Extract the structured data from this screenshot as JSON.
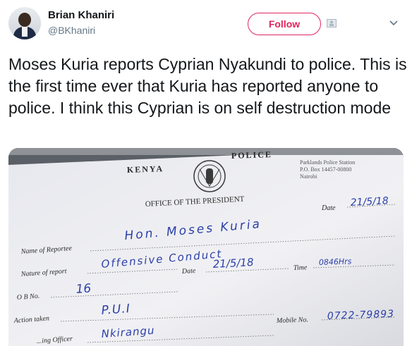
{
  "author": {
    "name": "Brian Khaniri",
    "handle": "@BKhaniri"
  },
  "actions": {
    "follow_label": "Follow",
    "follow_icon": "add-person-icon",
    "menu_icon": "chevron-down-icon"
  },
  "tweet": {
    "text": "Moses Kuria reports Cyprian Nyakundi to police. This is the first time ever that Kuria has reported anyone to police. I think this Cyprian is on self destruction mode"
  },
  "photo": {
    "form": {
      "country": "KENYA",
      "agency": "POLICE",
      "office": "OFFICE OF THE PRESIDENT",
      "station": [
        "Parklands Police Station",
        "P.O. Box 14457-00800",
        "Nairobi"
      ],
      "labels": {
        "date_top": "Date",
        "reportee": "Name of Reportee",
        "nature": "Nature of report",
        "date": "Date",
        "time": "Time",
        "ob_no": "O B No.",
        "action": "Action taken",
        "officer": "...ing Officer",
        "mobile": "Mobile No."
      },
      "handwriting": {
        "date_top": "21/5/18",
        "reportee": "Hon. Moses Kuria",
        "nature": "Offensive Conduct",
        "date": "21/5/18",
        "time": "0846Hrs",
        "ob_no": "16",
        "action": "P.U.I",
        "officer": "Nkirangu",
        "mobile": "0722-79893"
      }
    }
  },
  "colors": {
    "follow": "#e0245e",
    "ink": "#2b3fa8",
    "paper": "#eeeef2"
  }
}
